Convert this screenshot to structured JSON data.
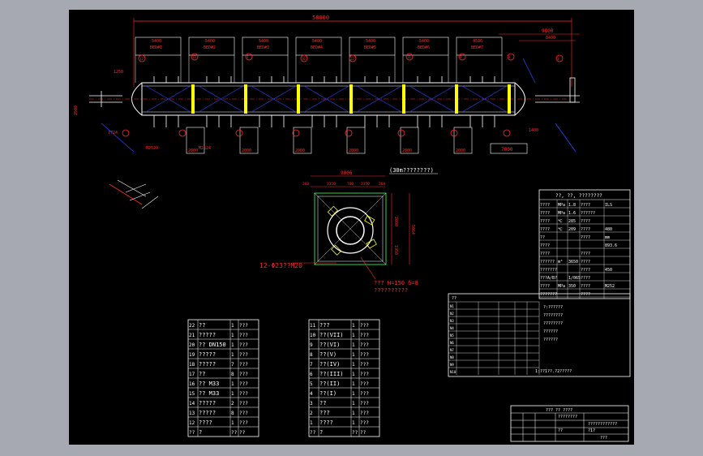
{
  "drawing": {
    "overall_dim": "58000",
    "right_dim": "9800",
    "right_dim2": "8400",
    "segment_dims": [
      "5400",
      "5400",
      "5400",
      "5400",
      "5400",
      "5400",
      "4536"
    ],
    "bed_labels": [
      "BED#1",
      "BED#2",
      "BED#3",
      "BED#4",
      "BED#5",
      "BED#6",
      "BED#7"
    ],
    "bottom_dims": [
      "2000",
      "2000",
      "2000",
      "2000",
      "2000",
      "2000"
    ],
    "right_bottom_dim": "7000",
    "small_dims": [
      "1250",
      "2500",
      "7724",
      "1400"
    ],
    "balloon_labels": [
      "12",
      "13",
      "3",
      "16",
      "23",
      "11",
      "9",
      "8",
      "3"
    ],
    "left_notes": [
      "M2520",
      "M2524"
    ]
  },
  "plan_view": {
    "title": "(30m????????)",
    "top_dim": "9006",
    "sub_dims": [
      "260",
      "3350",
      "700",
      "3350",
      "260"
    ],
    "right_dims": [
      "2000",
      "1950"
    ],
    "side_dim": "5064",
    "bolt_note": "12-Φ23??M20",
    "note_line1": "??? H=150 δ=8",
    "note_line2": "??????????"
  },
  "spec_table": {
    "header": "??, ??, ????????",
    "rows": [
      [
        "????",
        "MPa",
        "1.8",
        "????",
        "ILS"
      ],
      [
        "????",
        "MPa",
        "1.6",
        "??????",
        ""
      ],
      [
        "????",
        "℃",
        "285",
        "????",
        ""
      ],
      [
        "????",
        "℃",
        "209",
        "????",
        "480"
      ],
      [
        "??",
        "",
        "",
        "????",
        "mm"
      ],
      [
        "????",
        "",
        "",
        "",
        "893.6"
      ],
      [
        "????",
        "",
        "",
        "????",
        ""
      ],
      [
        "??????",
        "m³",
        "3650",
        "????",
        ""
      ],
      [
        "???????",
        "",
        "",
        "????",
        "450"
      ],
      [
        "???A/B?",
        "",
        "1/065",
        "????",
        ""
      ],
      [
        "????",
        "MPa",
        "350",
        "????",
        "M252"
      ],
      [
        "???????",
        "",
        "",
        "????",
        ""
      ]
    ]
  },
  "parts_left": [
    [
      "22",
      "??",
      "1",
      "???"
    ],
    [
      "21",
      "?????",
      "1",
      "???"
    ],
    [
      "20",
      "?? DN150",
      "1",
      "???"
    ],
    [
      "19",
      "?????",
      "1",
      "???"
    ],
    [
      "18",
      "?????",
      "7",
      "???"
    ],
    [
      "17",
      "??",
      "8",
      "???"
    ],
    [
      "16",
      "?? M33",
      "1",
      "???"
    ],
    [
      "15",
      "?? M33",
      "1",
      "???"
    ],
    [
      "14",
      "?????",
      "2",
      "???"
    ],
    [
      "13",
      "?????",
      "8",
      "???"
    ],
    [
      "12",
      "????",
      "1",
      "???"
    ],
    [
      "??",
      "?",
      "??",
      "??"
    ]
  ],
  "parts_mid": [
    [
      "11",
      "???",
      "1",
      "???"
    ],
    [
      "10",
      "??(VII)",
      "1",
      "???"
    ],
    [
      "9",
      "??(VI)",
      "1",
      "???"
    ],
    [
      "8",
      "??(V)",
      "1",
      "???"
    ],
    [
      "7",
      "??(IV)",
      "1",
      "???"
    ],
    [
      "6",
      "??(III)",
      "1",
      "???"
    ],
    [
      "5",
      "??(II)",
      "1",
      "???"
    ],
    [
      "4",
      "??(I)",
      "1",
      "???"
    ],
    [
      "3",
      "??",
      "1",
      "???"
    ],
    [
      "2",
      "???",
      "1",
      "???"
    ],
    [
      "1",
      "????",
      "1",
      "???"
    ],
    [
      "??",
      "?",
      "??",
      "??"
    ]
  ],
  "nozzle_table": {
    "title": "??",
    "right_notes": [
      "?:??????",
      "????????",
      "????????",
      "??????",
      "??????"
    ],
    "footer": "1:??1??.?2?????"
  },
  "title_block": {
    "line1": "??? ?? ????",
    "project": "????????",
    "drawing_name": "????????????",
    "sheet": "??",
    "sheet_no": "???",
    "scale": "?1?"
  },
  "colors": {
    "background": "#a6a9b1",
    "sheet": "#000000",
    "line": "#ffffff",
    "dim": "#ff2a2a",
    "blue": "#2b44ff",
    "yellow": "#ffff00",
    "green": "#33d433"
  }
}
